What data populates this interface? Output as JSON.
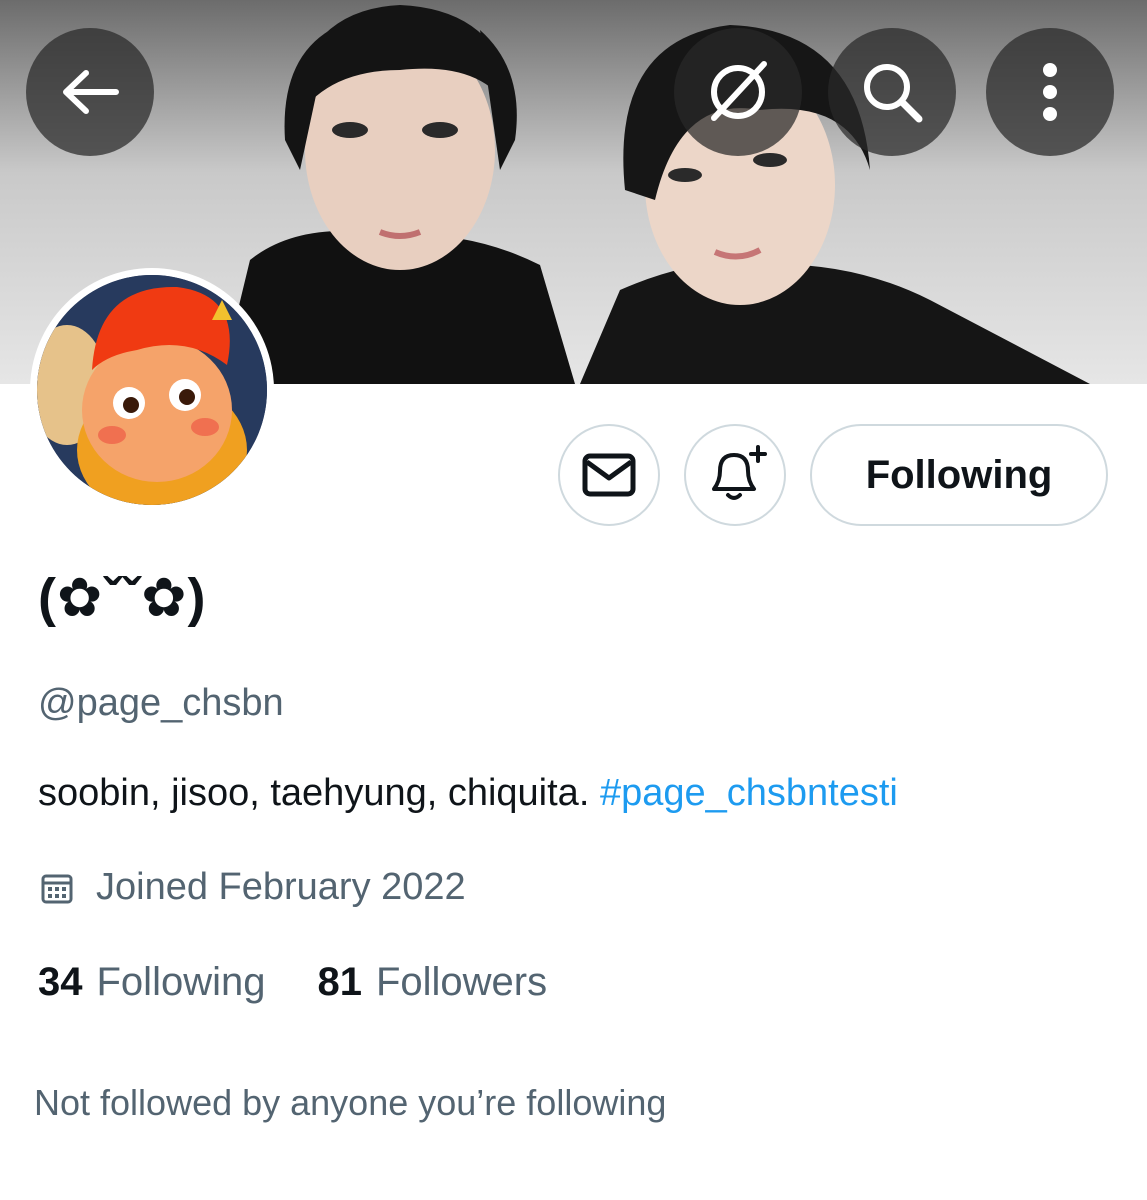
{
  "header": {
    "back_icon": "arrow-left-icon",
    "grok_icon": "slash-circle-icon",
    "search_icon": "search-icon",
    "more_icon": "more-vertical-icon"
  },
  "profile": {
    "display_name": "(✿ˇˇ✿)",
    "handle": "@page_chsbn",
    "bio_text": "soobin, jisoo, taehyung, chiquita.",
    "bio_hashtag": "#page_chsbntesti",
    "joined": "Joined February 2022",
    "following_count": "34",
    "following_label": "Following",
    "followers_count": "81",
    "followers_label": "Followers",
    "not_followed_note": "Not followed by anyone you’re following"
  },
  "actions": {
    "message_icon": "envelope-icon",
    "notify_icon": "bell-plus-icon",
    "follow_label": "Following"
  },
  "colors": {
    "text": "#0f1419",
    "muted": "#536471",
    "link": "#1d9bf0",
    "border": "#cfd9de"
  }
}
